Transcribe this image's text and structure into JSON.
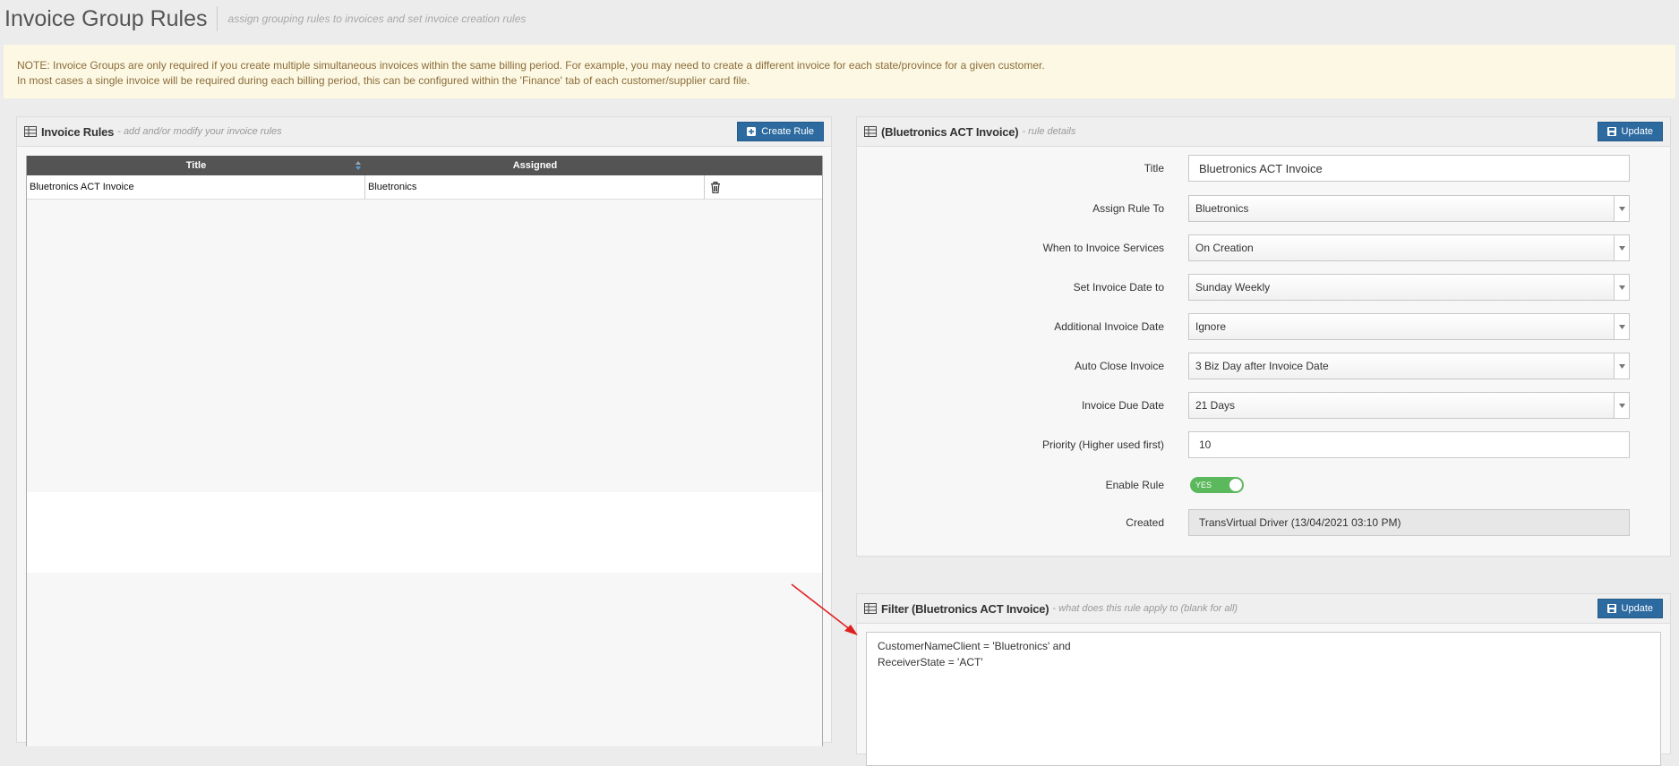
{
  "page": {
    "title": "Invoice Group Rules",
    "subtitle": "assign grouping rules to invoices and set invoice creation rules"
  },
  "note": {
    "line1": "NOTE: Invoice Groups are only required if you create multiple simultaneous invoices within the same billing period. For example, you may need to create a different invoice for each state/province for a given customer.",
    "line2": "In most cases a single invoice will be required during each billing period, this can be configured within the 'Finance' tab of each customer/supplier card file."
  },
  "rules_panel": {
    "title": "Invoice Rules",
    "subtitle": "- add and/or modify your invoice rules",
    "create_label": "Create Rule",
    "columns": [
      "Title",
      "Assigned"
    ],
    "rows": [
      {
        "title": "Bluetronics ACT Invoice",
        "assigned": "Bluetronics"
      }
    ]
  },
  "rule_details": {
    "title": "(Bluetronics ACT Invoice)",
    "subtitle": "- rule details",
    "update_label": "Update",
    "fields": [
      {
        "label": "Title",
        "value": "Bluetronics ACT Invoice",
        "kind": "text"
      },
      {
        "label": "Assign Rule To",
        "value": "Bluetronics",
        "kind": "select"
      },
      {
        "label": "When to Invoice Services",
        "value": "On Creation",
        "kind": "select"
      },
      {
        "label": "Set Invoice Date to",
        "value": "Sunday Weekly",
        "kind": "select"
      },
      {
        "label": "Additional Invoice Date",
        "value": "Ignore",
        "kind": "select"
      },
      {
        "label": "Auto Close Invoice",
        "value": "3 Biz Day after Invoice Date",
        "kind": "select"
      },
      {
        "label": "Invoice Due Date",
        "value": "21 Days",
        "kind": "select"
      },
      {
        "label": "Priority (Higher used first)",
        "value": "10",
        "kind": "text"
      }
    ],
    "enable_label": "Enable Rule",
    "enable_value": "YES",
    "created_label": "Created",
    "created_value": "TransVirtual Driver (13/04/2021 03:10 PM)"
  },
  "filter_panel": {
    "title": "Filter (Bluetronics ACT Invoice)",
    "subtitle": "- what does this rule apply to (blank for all)",
    "update_label": "Update",
    "lines": [
      "CustomerNameClient = 'Bluetronics' and",
      "ReceiverState = 'ACT'"
    ]
  },
  "colors": {
    "button": "#2c6aa0",
    "table_header": "#545454",
    "note_bg": "#fdf8e3",
    "note_text": "#8a6d3b",
    "toggle_on": "#5cb85c",
    "arrow": "#e02020"
  }
}
